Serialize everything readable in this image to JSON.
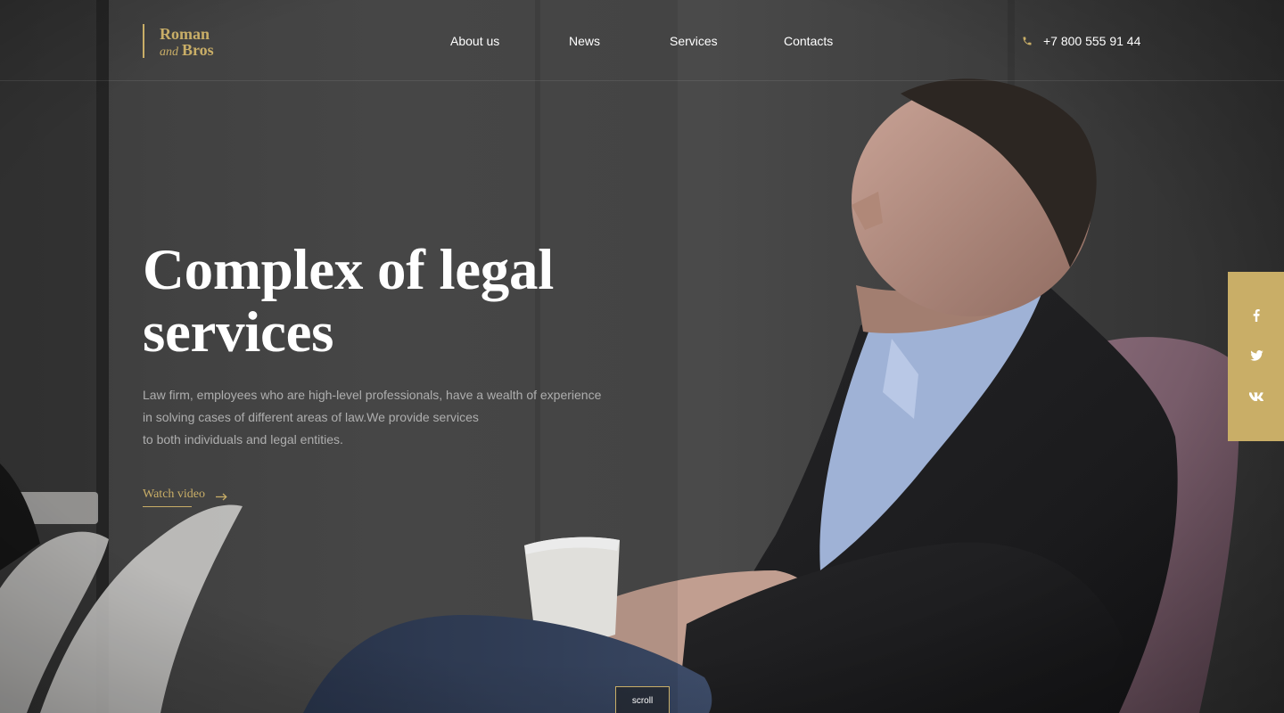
{
  "brand": {
    "line1": "Roman",
    "and": "and",
    "bros": "Bros",
    "accent_color": "#c9ae67"
  },
  "nav": {
    "about": "About us",
    "news": "News",
    "services": "Services",
    "contacts": "Contacts"
  },
  "phone": {
    "icon": "phone-icon",
    "number": "+7 800 555 91 44"
  },
  "hero": {
    "title": "Complex of legal services",
    "description_lines": [
      "Law firm, employees who are high-level professionals, have a wealth of experience",
      "in solving cases of different areas of law.We provide services",
      "to both individuals and legal entities."
    ],
    "watch_video": "Watch video"
  },
  "social": {
    "icons": [
      "facebook-icon",
      "twitter-icon",
      "vk-icon"
    ]
  },
  "scroll_label": "scroll"
}
